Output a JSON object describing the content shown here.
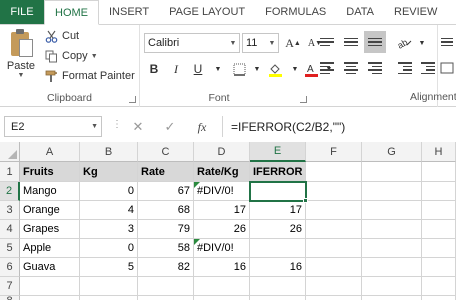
{
  "ribbon_tabs": [
    "FILE",
    "HOME",
    "INSERT",
    "PAGE LAYOUT",
    "FORMULAS",
    "DATA",
    "REVIEW"
  ],
  "active_tab": "HOME",
  "clipboard": {
    "paste_label": "Paste",
    "cut_label": "Cut",
    "copy_label": "Copy",
    "format_painter_label": "Format Painter",
    "group_label": "Clipboard"
  },
  "font": {
    "family": "Calibri",
    "size": "11",
    "group_label": "Font",
    "bold": "B",
    "italic": "I",
    "underline": "U",
    "grow": "A",
    "shrink": "A"
  },
  "alignment": {
    "group_label": "Alignment"
  },
  "formula_bar": {
    "name_box": "E2",
    "cancel": "✕",
    "enter": "✓",
    "fx": "fx",
    "formula": "=IFERROR(C2/B2,\"\")"
  },
  "columns": [
    "A",
    "B",
    "C",
    "D",
    "E",
    "F",
    "G",
    "H"
  ],
  "rows": [
    "1",
    "2",
    "3",
    "4",
    "5",
    "6",
    "7",
    "8"
  ],
  "sheet": {
    "header": [
      "Fruits",
      "Kg",
      "Rate",
      "Rate/Kg",
      "IFERROR"
    ],
    "data": [
      [
        "Mango",
        "0",
        "67",
        "#DIV/0!",
        ""
      ],
      [
        "Orange",
        "4",
        "68",
        "17",
        "17"
      ],
      [
        "Grapes",
        "3",
        "79",
        "26",
        "26"
      ],
      [
        "Apple",
        "0",
        "58",
        "#DIV/0!",
        ""
      ],
      [
        "Guava",
        "5",
        "82",
        "16",
        "16"
      ]
    ]
  },
  "colors": {
    "accent": "#217346",
    "error_indicator": "#2a8a3e",
    "header_fill": "#d8d8d8"
  }
}
